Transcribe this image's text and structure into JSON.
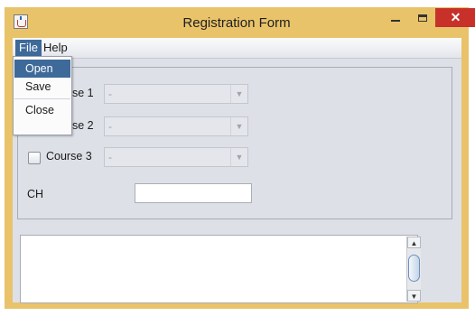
{
  "window": {
    "title": "Registration Form",
    "close_glyph": "✕"
  },
  "menubar": {
    "items": [
      {
        "label": "File"
      },
      {
        "label": "Help"
      }
    ]
  },
  "file_menu": {
    "items": [
      {
        "label": "Open",
        "highlighted": true
      },
      {
        "label": "Save"
      },
      {
        "label": "Close"
      }
    ]
  },
  "courses": [
    {
      "label_visible": "se 1",
      "checked": false,
      "selected_value": "-"
    },
    {
      "label_visible": "se 2",
      "checked": false,
      "selected_value": "-"
    },
    {
      "label": "Course 3",
      "checked": false,
      "selected_value": "-"
    }
  ],
  "ch": {
    "label": "CH",
    "value": ""
  },
  "output": {
    "value": ""
  },
  "icons": {
    "app": "java-cup-icon",
    "minimize": "minimize-icon",
    "maximize": "maximize-icon",
    "close": "close-icon",
    "combo_arrow": "chevron-down-icon",
    "scroll_up": "arrow-up-icon",
    "scroll_down": "arrow-down-icon"
  },
  "colors": {
    "titlebar": "#e9c36a",
    "close_button": "#c7312a",
    "menu_highlight": "#3e6a9a",
    "client_background": "#dde0e7"
  }
}
